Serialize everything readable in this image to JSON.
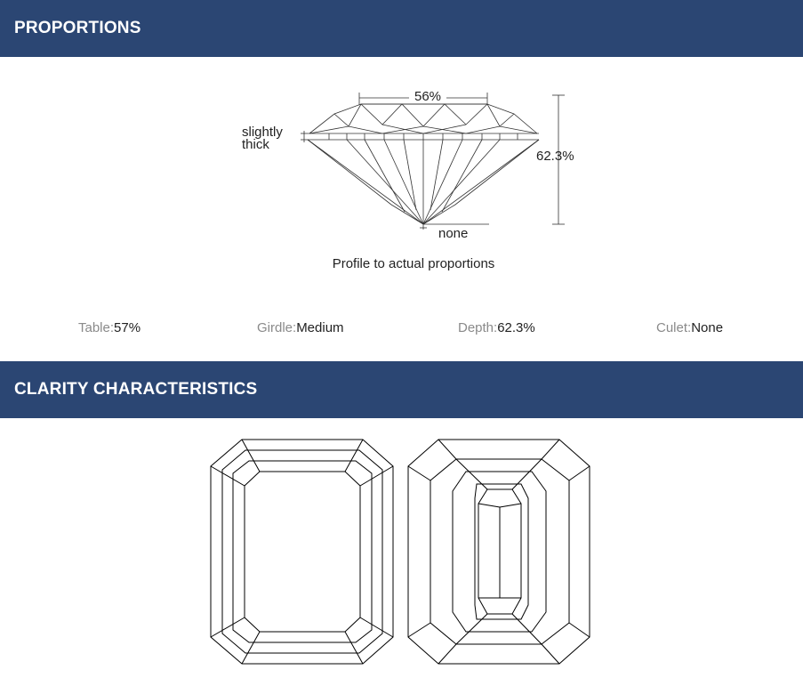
{
  "sections": {
    "proportions": {
      "title": "PROPORTIONS"
    },
    "clarity": {
      "title": "CLARITY CHARACTERISTICS"
    }
  },
  "profile": {
    "table_label": "56%",
    "depth_label": "62.3%",
    "girdle_label_line1": "slightly",
    "girdle_label_line2": "thick",
    "culet_label": "none",
    "caption": "Profile to actual proportions"
  },
  "stats": [
    {
      "label": "Table:",
      "value": "57%"
    },
    {
      "label": "Girdle:",
      "value": "Medium"
    },
    {
      "label": "Depth:",
      "value": "62.3%"
    },
    {
      "label": "Culet:",
      "value": "None"
    }
  ],
  "colors": {
    "header_bg": "#2b4673",
    "header_text": "#ffffff",
    "label_text": "#8a8a8a",
    "value_text": "#222222"
  }
}
